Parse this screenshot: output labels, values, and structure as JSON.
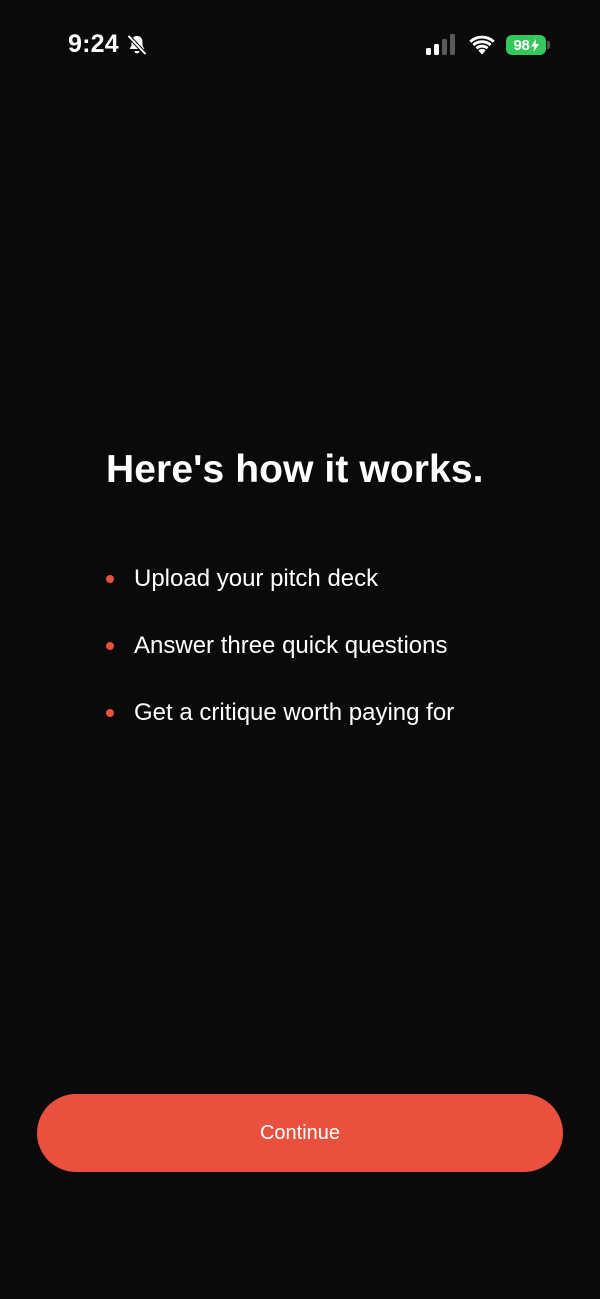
{
  "status_bar": {
    "time": "9:24",
    "battery_level": "98",
    "icons": [
      "bell-slash-icon",
      "cellular-signal-icon",
      "wifi-icon",
      "battery-charging-icon"
    ],
    "battery_color": "#34c759"
  },
  "main": {
    "headline": "Here's how it works.",
    "steps": [
      {
        "label": "Upload your pitch deck"
      },
      {
        "label": "Answer three quick questions"
      },
      {
        "label": "Get a critique worth paying for"
      }
    ],
    "bullet_color": "#e9503e"
  },
  "footer": {
    "continue_label": "Continue",
    "accent_color": "#e9503e"
  },
  "theme": {
    "background": "#0a0a0a",
    "text": "#ffffff"
  }
}
